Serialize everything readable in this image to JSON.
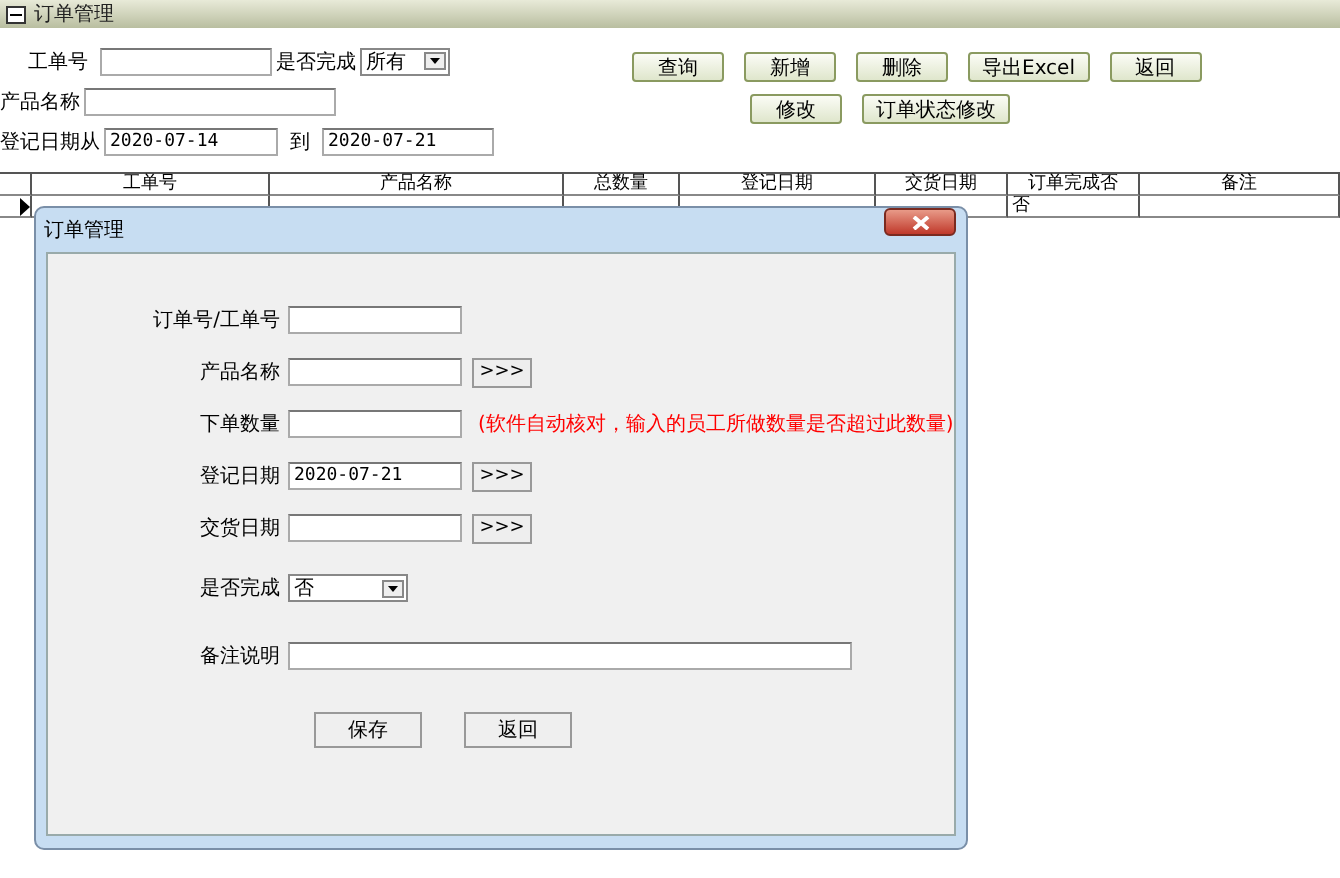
{
  "window": {
    "title": "订单管理"
  },
  "filters": {
    "order_no": {
      "label": "工单号"
    },
    "completed": {
      "label": "是否完成",
      "value": "所有"
    },
    "product": {
      "label": "产品名称"
    },
    "date_from": {
      "label": "登记日期从",
      "value": "2020-07-14"
    },
    "date_to": {
      "label": "到",
      "value": "2020-07-21"
    }
  },
  "toolbar": [
    [
      "查询",
      "新增",
      "删除",
      "导出Excel",
      "返回"
    ],
    [
      "修改",
      "订单状态修改"
    ]
  ],
  "table": {
    "columns": [
      "工单号",
      "产品名称",
      "总数量",
      "登记日期",
      "交货日期",
      "订单完成否",
      "备注"
    ],
    "rows": [
      {
        "selected": true,
        "cells": [
          null,
          null,
          null,
          null,
          null,
          "否",
          null
        ]
      }
    ]
  },
  "dialog": {
    "title": "订单管理",
    "fields": [
      {
        "kind": "text",
        "label": "订单号/工单号"
      },
      {
        "kind": "picker",
        "label": "产品名称",
        "button": ">>>"
      },
      {
        "kind": "text",
        "label": "下单数量",
        "hint": "(软件自动核对，输入的员工所做数量是否超过此数量)"
      },
      {
        "kind": "picker",
        "label": "登记日期",
        "value": "2020-07-21",
        "button": ">>>"
      },
      {
        "kind": "picker",
        "label": "交货日期",
        "button": ">>>"
      },
      {
        "kind": "select",
        "label": "是否完成",
        "value": "否"
      },
      {
        "kind": "wide",
        "label": "备注说明"
      }
    ],
    "buttons": [
      "保存",
      "返回"
    ]
  }
}
